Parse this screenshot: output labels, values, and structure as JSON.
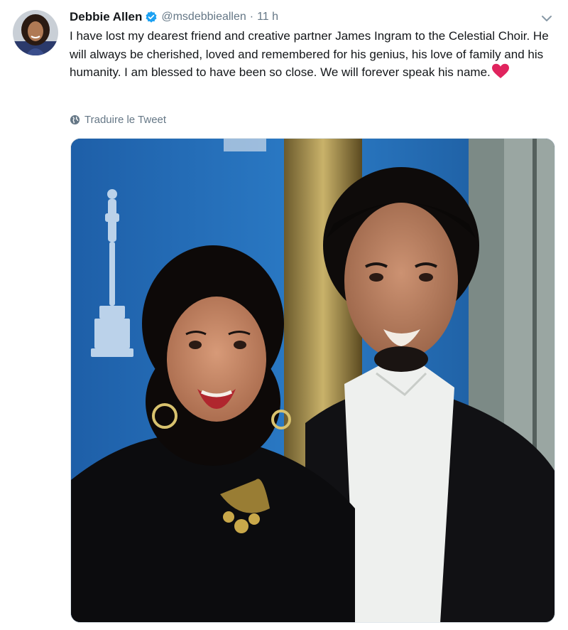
{
  "tweet": {
    "display_name": "Debbie Allen",
    "handle": "@msdebbieallen",
    "separator": "·",
    "time": "11 h",
    "text": "I have lost my dearest friend and creative partner James Ingram to the Celestial Choir. He will always be cherished, loved and remembered for his genius, his love of family and his humanity. I am blessed to have been so close. We will forever speak his name.",
    "translate_label": "Traduire le Tweet"
  },
  "icons": {
    "verified": "verified-badge-icon",
    "heart": "red-heart-emoji-icon",
    "caret": "chevron-down-icon",
    "globe": "globe-icon"
  },
  "colors": {
    "text": "#14171a",
    "secondary": "#657786",
    "verified_blue": "#1da1f2",
    "heart_red": "#e0245e"
  }
}
